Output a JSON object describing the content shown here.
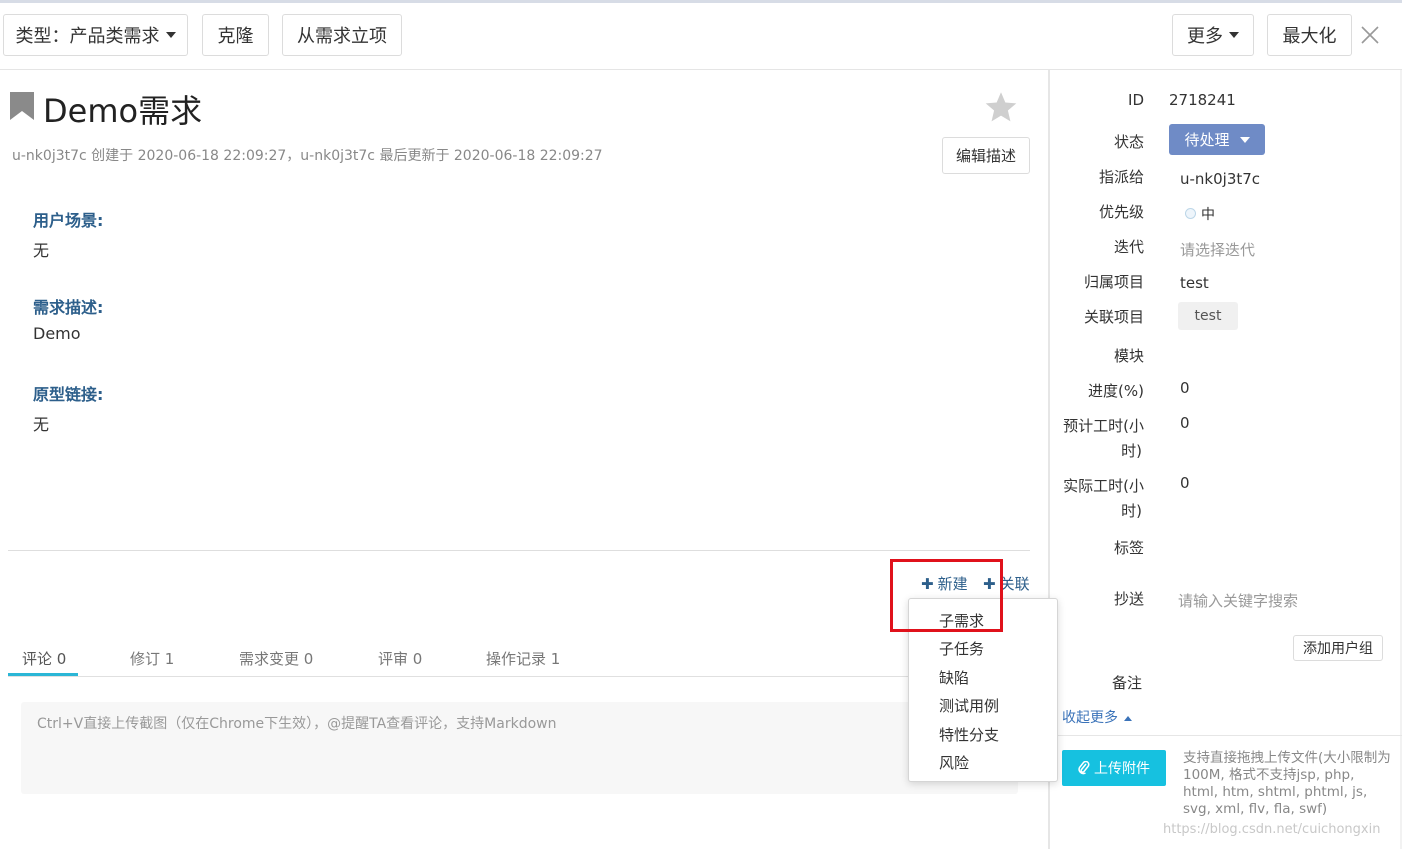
{
  "toolbar": {
    "type_label": "类型：产品类需求",
    "clone_label": "克隆",
    "from_req_label": "从需求立项",
    "more_label": "更多",
    "maximize_label": "最大化"
  },
  "story": {
    "title": "Demo需求",
    "meta": "u-nk0j3t7c 创建于 2020-06-18 22:09:27，u-nk0j3t7c 最后更新于 2020-06-18 22:09:27",
    "edit_label": "编辑描述",
    "sections": [
      {
        "label": "用户场景:",
        "value": "无"
      },
      {
        "label": "需求描述:",
        "value": "Demo"
      },
      {
        "label": "原型链接:",
        "value": "无"
      }
    ]
  },
  "actions": {
    "new_label": "新建",
    "link_label": "关联",
    "menu": [
      "子需求",
      "子任务",
      "缺陷",
      "测试用例",
      "特性分支",
      "风险"
    ]
  },
  "tabs": [
    "评论 0",
    "修订 1",
    "需求变更 0",
    "评审 0",
    "操作记录 1"
  ],
  "comment": {
    "placeholder": "Ctrl+V直接上传截图（仅在Chrome下生效），@提醒TA查看评论，支持Markdown"
  },
  "fields": {
    "id_label": "ID",
    "id_value": "2718241",
    "status_label": "状态",
    "status_value": "待处理",
    "assignee_label": "指派给",
    "assignee_value": "u-nk0j3t7c",
    "priority_label": "优先级",
    "priority_value": "中",
    "iteration_label": "迭代",
    "iteration_placeholder": "请选择迭代",
    "project_label": "归属项目",
    "project_value": "test",
    "related_label": "关联项目",
    "related_value": "test",
    "module_label": "模块",
    "progress_label": "进度(%)",
    "progress_value": "0",
    "est_label_1": "预计工时(小",
    "est_label_2": "时)",
    "est_value": "0",
    "actual_label_1": "实际工时(小",
    "actual_label_2": "时)",
    "actual_value": "0",
    "tags_label": "标签",
    "cc_label": "抄送",
    "cc_placeholder": "请输入关键字搜索",
    "add_group_label": "添加用户组",
    "note_label": "备注",
    "collapse_label": "收起更多"
  },
  "attachments": {
    "upload_label": "上传附件",
    "hint": "支持直接拖拽上传文件(大小限制为100M, 格式不支持jsp, php, html, htm, shtml, phtml, js, svg, xml, flv, fla, swf)"
  },
  "watermark": "https://blog.csdn.net/cuichongxin",
  "colors": {
    "accent_blue": "#2d5f8b",
    "status_bg": "#6f8bc6",
    "upload_bg": "#16c1e0",
    "tab_active": "#2bb6d6",
    "highlight_red": "#e0111b"
  }
}
